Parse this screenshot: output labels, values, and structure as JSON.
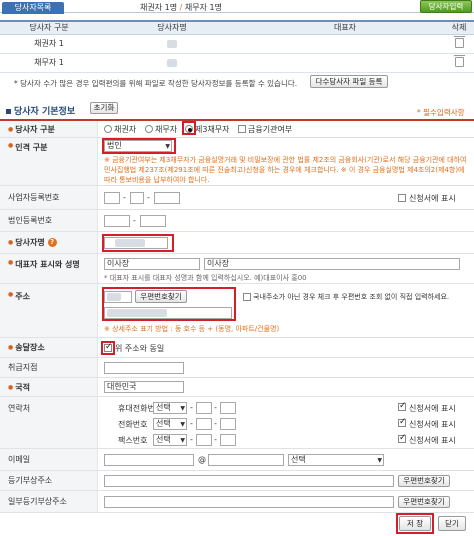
{
  "tabs": {
    "active": "당사자목록"
  },
  "summary": {
    "creditor": "채권자 1명",
    "sep": "/",
    "debtor": "채무자 1명"
  },
  "top_button": "당사자입력",
  "list": {
    "headers": [
      "당사자 구분",
      "당사자명",
      "대표자",
      "삭제"
    ],
    "rows": [
      {
        "type": "채권자 1"
      },
      {
        "type": "채무자 1"
      }
    ]
  },
  "notice": "* 당사자 수가 많은 경우 입력편의를 위해 파일로 작성한 당사자정보를 등록할 수 있습니다.",
  "bulk_button": "다수당사자 파일 등록",
  "section_title": "당사자 기본정보",
  "reset_button": "초기화",
  "required_note": "* 필수입력사항",
  "fields": {
    "party_type": {
      "label": "당사자 구분",
      "options": [
        "채권자",
        "채무자",
        "제3채무자",
        "금융기관여부"
      ],
      "selected": "제3채무자"
    },
    "person_type": {
      "label": "인격 구분",
      "value": "법인",
      "note": "※ 금융기관여부는 제3채무자가 금융실명거래 및 비밀보장에 관한 법률 제2조의 금융회사(기관)로서 해당 금융기관에 대하여 민사집행법 제237조(제291조에 따른 진술최고)신청을 하는 경우에 체크합니다. ※ 이 경우 금융실명법 제4조의2(제4항)에 따라 통보비용을 납부하여야 합니다."
    },
    "biz_reg_no": {
      "label": "사업자등록번호",
      "display_check": "신청서에 표시"
    },
    "corp_reg_no": {
      "label": "법인등록번호"
    },
    "party_name": {
      "label": "당사자명"
    },
    "representative": {
      "label": "대표자 표시와 성명",
      "title_value": "이사장",
      "name_value": "이사장",
      "note": "* 대표자 표시를 대표자 성명과 함께 입력하십시오. 예)대표이사 홍00"
    },
    "address": {
      "label": "주소",
      "search_button": "우편번호찾기",
      "foreign_check": "국내주소가 아닌 경우 체크 후 우편번호 조회 없이 직접 입력하세요.",
      "note": "※ 상세주소 표기 방법 : 동 호수 등 + (동명, 아파트/건물명)"
    },
    "service_place": {
      "label": "송달장소",
      "same_check": "위 주소와 동일"
    },
    "branch": {
      "label": "취급지점"
    },
    "nationality": {
      "label": "국적",
      "value": "대한민국"
    },
    "contact": {
      "label": "연락처",
      "rows": [
        {
          "label": "휴대전화번호",
          "select": "선택",
          "check": "신청서에 표시"
        },
        {
          "label": "전화번호",
          "select": "선택",
          "check": "신청서에 표시"
        },
        {
          "label": "팩스번호",
          "select": "선택",
          "check": "신청서에 표시"
        }
      ]
    },
    "email": {
      "label": "이메일",
      "at": "@",
      "select": "선택"
    },
    "reg_addr": {
      "label": "등기부상주소",
      "search_button": "우편번호찾기"
    },
    "partial_reg_addr": {
      "label": "일부등기부상주소",
      "search_button": "우편번호찾기"
    }
  },
  "footer": {
    "save": "저 장",
    "close": "닫기"
  }
}
